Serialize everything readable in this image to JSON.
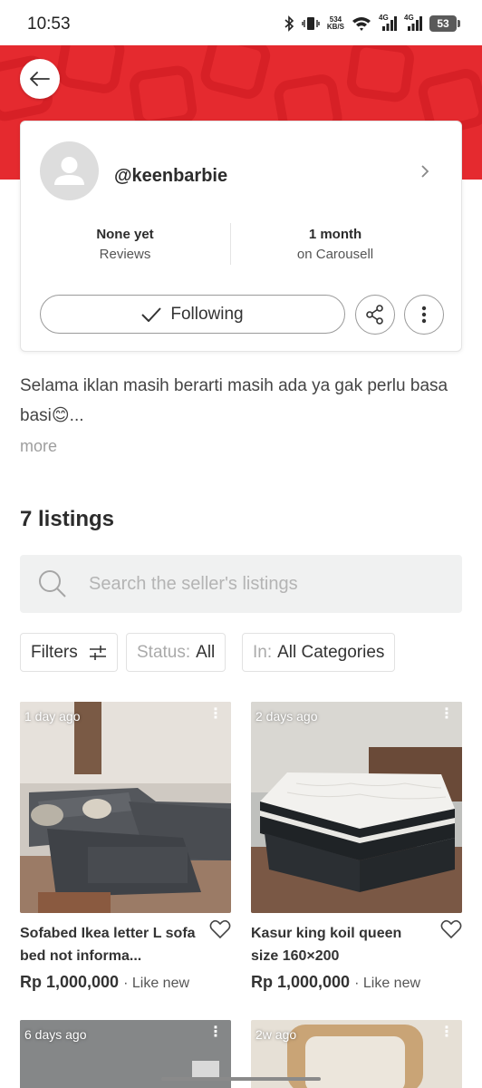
{
  "status_bar": {
    "time": "10:53",
    "speed_value": "534",
    "speed_unit": "KB/S",
    "network_1": "4G",
    "network_2": "4G",
    "battery": "53"
  },
  "profile": {
    "username": "@keenbarbie",
    "stats": [
      {
        "value": "None yet",
        "label": "Reviews"
      },
      {
        "value": "1 month",
        "label": "on Carousell"
      }
    ],
    "follow_label": "Following"
  },
  "bio": {
    "text": "Selama iklan masih berarti masih ada ya gak perlu basa basi😊...",
    "more_label": "more"
  },
  "listings": {
    "title": "7 listings",
    "search_placeholder": "Search the seller's listings",
    "filters_label": "Filters",
    "status_prefix": "Status:",
    "status_value": "All",
    "in_prefix": "In:",
    "category_value": "All Categories",
    "items": [
      {
        "time": "1 day ago",
        "title": "Sofabed Ikea letter L sofa bed not informa...",
        "price": "Rp 1,000,000",
        "condition": "· Like new"
      },
      {
        "time": "2 days ago",
        "title": "Kasur king koil queen size 160×200",
        "price": "Rp 1,000,000",
        "condition": "· Like new"
      },
      {
        "time": "6 days ago"
      },
      {
        "time": "2w ago"
      }
    ]
  },
  "colors": {
    "brand": "#e52a2f",
    "text": "#2c2c2c",
    "muted": "#9e9e9e"
  }
}
